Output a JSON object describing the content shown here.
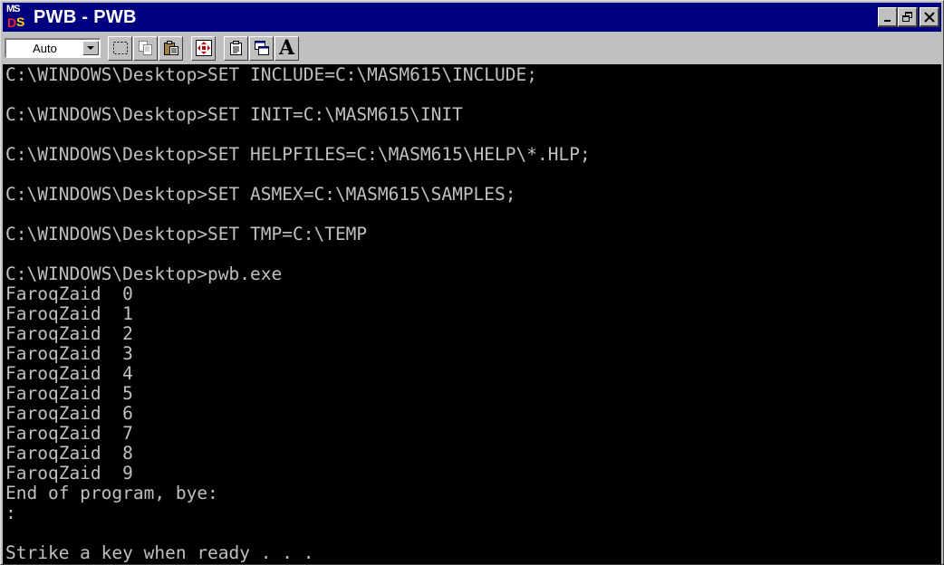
{
  "window": {
    "title": "PWB - PWB",
    "icon": {
      "top": "MS",
      "left": "D",
      "right": "S",
      "name": "ms-dos-icon"
    },
    "controls": {
      "minimize": "_",
      "restore": "❐",
      "close": "✕"
    }
  },
  "toolbar": {
    "font_select": {
      "value": "Auto",
      "options_visible": [
        "Auto"
      ]
    },
    "buttons": [
      {
        "name": "mark-icon"
      },
      {
        "name": "copy-icon"
      },
      {
        "name": "paste-icon"
      },
      {
        "name": "fullscreen-icon"
      },
      {
        "name": "properties-icon"
      },
      {
        "name": "background-icon"
      },
      {
        "name": "font-icon",
        "label": "A"
      }
    ]
  },
  "console": {
    "colors": {
      "background": "#000000",
      "text": "#c0c0c0"
    },
    "lines": [
      "C:\\WINDOWS\\Desktop>SET INCLUDE=C:\\MASM615\\INCLUDE;",
      "",
      "C:\\WINDOWS\\Desktop>SET INIT=C:\\MASM615\\INIT",
      "",
      "C:\\WINDOWS\\Desktop>SET HELPFILES=C:\\MASM615\\HELP\\*.HLP;",
      "",
      "C:\\WINDOWS\\Desktop>SET ASMEX=C:\\MASM615\\SAMPLES;",
      "",
      "C:\\WINDOWS\\Desktop>SET TMP=C:\\TEMP",
      "",
      "C:\\WINDOWS\\Desktop>pwb.exe",
      "FaroqZaid  0",
      "FaroqZaid  1",
      "FaroqZaid  2",
      "FaroqZaid  3",
      "FaroqZaid  4",
      "FaroqZaid  5",
      "FaroqZaid  6",
      "FaroqZaid  7",
      "FaroqZaid  8",
      "FaroqZaid  9",
      "End of program, bye:",
      ":",
      "",
      "Strike a key when ready . . ."
    ]
  }
}
